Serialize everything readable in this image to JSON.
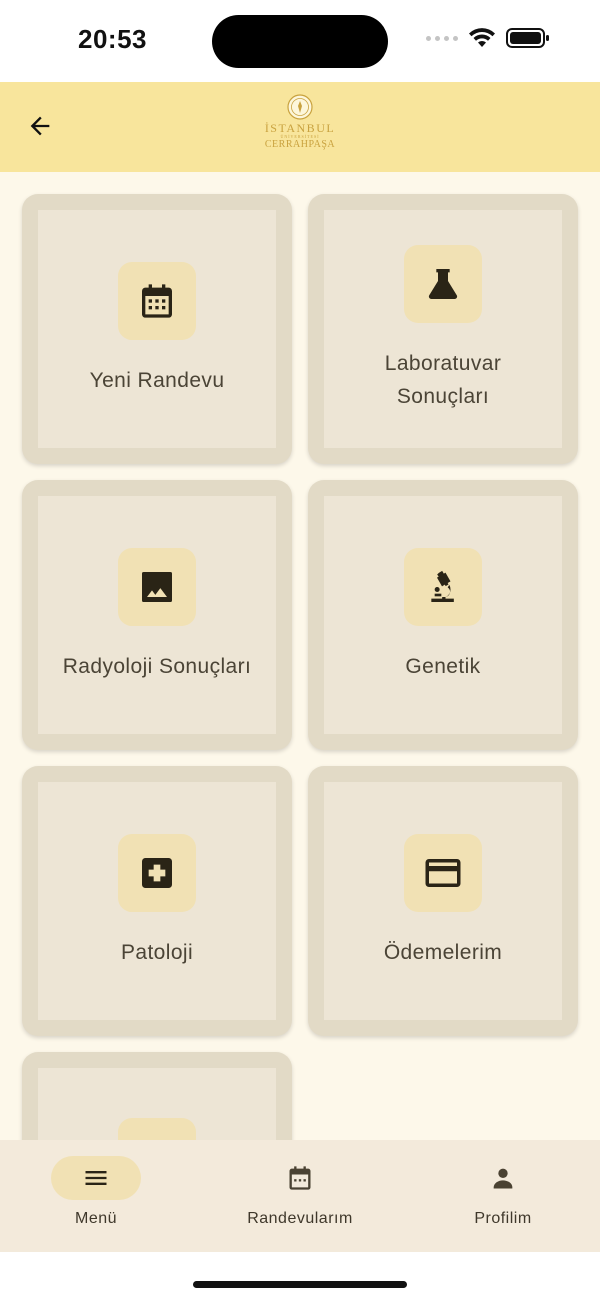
{
  "status_bar": {
    "time": "20:53"
  },
  "app_bar": {
    "logo": {
      "line1": "İSTANBUL",
      "line2": "ÜNİVERSİTESİ",
      "line3": "CERRAHPAŞA"
    }
  },
  "menu": {
    "items": [
      {
        "label": "Yeni Randevu",
        "icon": "calendar-icon"
      },
      {
        "label": "Laboratuvar Sonuçları",
        "icon": "flask-icon"
      },
      {
        "label": "Radyoloji Sonuçları",
        "icon": "image-icon"
      },
      {
        "label": "Genetik",
        "icon": "microscope-icon"
      },
      {
        "label": "Patoloji",
        "icon": "medical-cross-icon"
      },
      {
        "label": "Ödemelerim",
        "icon": "credit-card-icon"
      },
      {
        "label": "",
        "icon": ""
      }
    ]
  },
  "bottom_nav": {
    "items": [
      {
        "label": "Menü",
        "icon": "menu-icon",
        "active": true
      },
      {
        "label": "Randevularım",
        "icon": "calendar-icon",
        "active": false
      },
      {
        "label": "Profilim",
        "icon": "person-icon",
        "active": false
      }
    ]
  },
  "colors": {
    "app_bar": "#f8e59c",
    "background": "#fdf8ea",
    "card_outer": "#e2dac6",
    "card_inner": "#ede5d5",
    "icon_box": "#f1e1b4",
    "icon": "#2a2416",
    "logo_gold": "#c9a23f"
  }
}
